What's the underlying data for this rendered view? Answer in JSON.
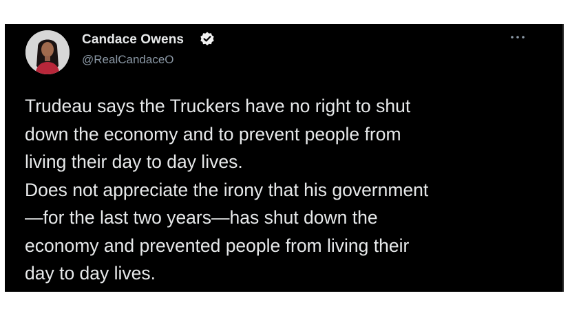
{
  "tweet": {
    "author": {
      "display_name": "Candace Owens",
      "handle": "@RealCandaceO",
      "verified": true,
      "verified_icon": "verified-badge-icon",
      "avatar": "profile-photo"
    },
    "more_icon": "more-options-icon",
    "text_lines": [
      "Trudeau says the Truckers have no right to shut",
      "down the economy and to prevent people from",
      "living their day to day lives.",
      "Does not appreciate the irony that his government",
      "—for the last two years—has shut down the",
      "economy and prevented people from living their",
      "day to day lives."
    ]
  },
  "colors": {
    "card_background": "#000000",
    "text_primary": "#e7e9ea",
    "text_secondary": "#8b98a5",
    "page_background": "#ffffff"
  }
}
